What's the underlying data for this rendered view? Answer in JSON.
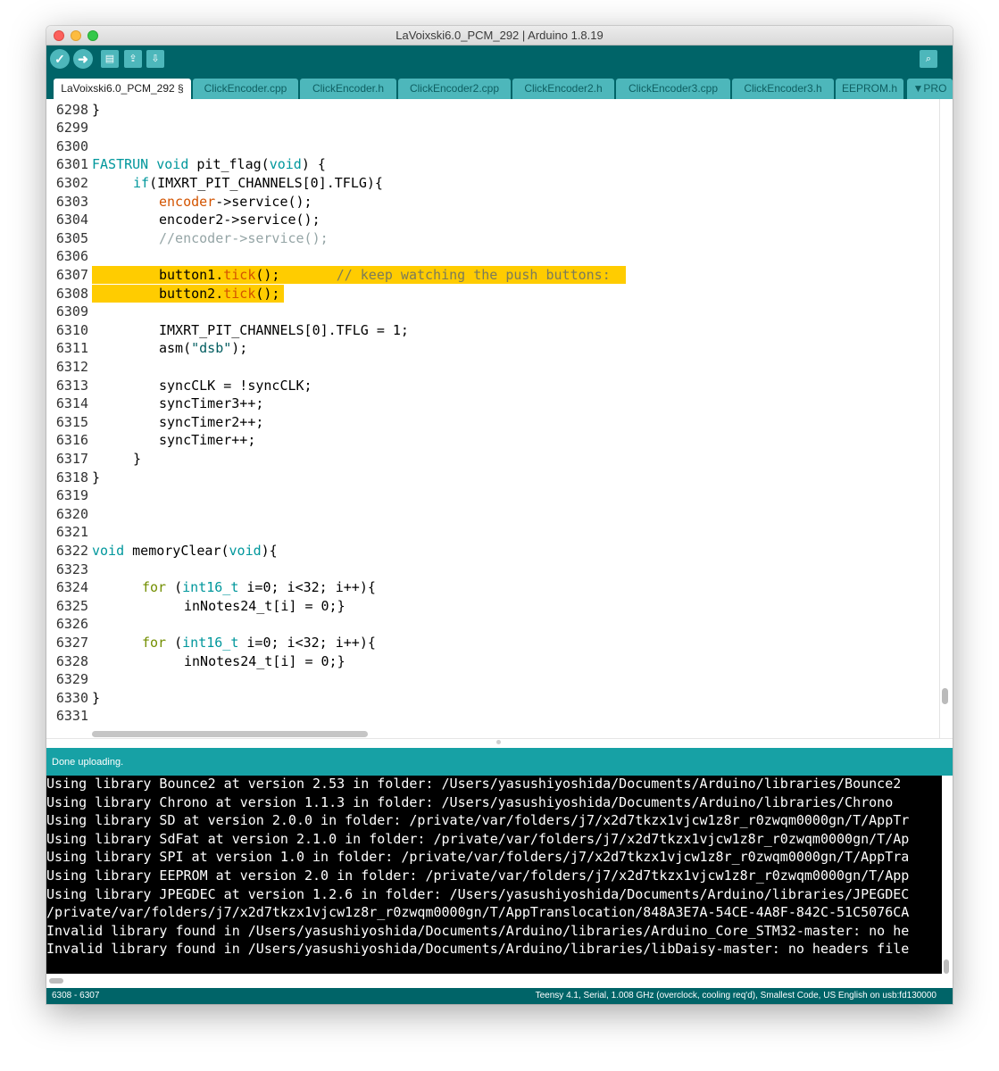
{
  "window": {
    "title": "LaVoixski6.0_PCM_292 | Arduino 1.8.19"
  },
  "traffic_lights": {
    "close_color": "#fc605c",
    "minimize_color": "#fdbc40",
    "zoom_color": "#34c84a"
  },
  "toolbar": {
    "verify_icon": "✓",
    "upload_icon": "➜",
    "new_icon": "▤",
    "open_icon": "⇪",
    "save_icon": "⇩",
    "serial_monitor_icon": "⌕"
  },
  "tabs": [
    {
      "label": "LaVoixski6.0_PCM_292 §",
      "active": true
    },
    {
      "label": "ClickEncoder.cpp"
    },
    {
      "label": "ClickEncoder.h"
    },
    {
      "label": "ClickEncoder2.cpp"
    },
    {
      "label": "ClickEncoder2.h"
    },
    {
      "label": "ClickEncoder3.cpp"
    },
    {
      "label": "ClickEncoder3.h"
    },
    {
      "label": "EEPROM.h"
    },
    {
      "label": "▼PRO"
    }
  ],
  "editor": {
    "line_numbers": [
      "6298",
      "6299",
      "6300",
      "6301",
      "6302",
      "6303",
      "6304",
      "6305",
      "6306",
      "6307",
      "6308",
      "6309",
      "6310",
      "6311",
      "6312",
      "6313",
      "6314",
      "6315",
      "6316",
      "6317",
      "6318",
      "6319",
      "6320",
      "6321",
      "6322",
      "6323",
      "6324",
      "6325",
      "6326",
      "6327",
      "6328",
      "6329",
      "6330",
      "6331"
    ],
    "code": {
      "l6298": "}",
      "l6301_kw1": "FASTRUN",
      "l6301_kw2": "void",
      "l6301_name": " pit_flag(",
      "l6301_kw3": "void",
      "l6301_end": ") {",
      "l6302_kw": "if",
      "l6302_rest": "(IMXRT_PIT_CHANNELS[0].TFLG){",
      "l6303_fn": "encoder",
      "l6303_rest": "->service();",
      "l6304": "encoder2->service();",
      "l6305": "//encoder->service();",
      "l6307_a": "button1.",
      "l6307_fn": "tick",
      "l6307_b": "();       ",
      "l6307_cm": "// keep watching the push buttons:",
      "l6308_a": "button2.",
      "l6308_fn": "tick",
      "l6308_b": "();",
      "l6310": "IMXRT_PIT_CHANNELS[0].TFLG = 1;",
      "l6311_a": "asm(",
      "l6311_str": "\"dsb\"",
      "l6311_b": ");",
      "l6313": "syncCLK = !syncCLK;",
      "l6314": "syncTimer3++;",
      "l6315": "syncTimer2++;",
      "l6316": "syncTimer++;",
      "l6317": "}",
      "l6318": "}",
      "l6322_kw": "void",
      "l6322_name": " memoryClear(",
      "l6322_kw2": "void",
      "l6322_end": "){",
      "l6324_kw": "for",
      "l6324_sp": " (",
      "l6324_type": "int16_t",
      "l6324_rest": " i=0; i<32; i++){",
      "l6325": "inNotes24_t[i] = 0;}",
      "l6327_kw": "for",
      "l6327_sp": " (",
      "l6327_type": "int16_t",
      "l6327_rest": " i=0; i<32; i++){",
      "l6328": "inNotes24_t[i] = 0;}",
      "l6330": "}"
    }
  },
  "status": {
    "message": "Done uploading."
  },
  "console": {
    "lines": [
      "Using library Bounce2 at version 2.53 in folder: /Users/yasushiyoshida/Documents/Arduino/libraries/Bounce2",
      "Using library Chrono at version 1.1.3 in folder: /Users/yasushiyoshida/Documents/Arduino/libraries/Chrono",
      "Using library SD at version 2.0.0 in folder: /private/var/folders/j7/x2d7tkzx1vjcw1z8r_r0zwqm0000gn/T/AppTr",
      "Using library SdFat at version 2.1.0 in folder: /private/var/folders/j7/x2d7tkzx1vjcw1z8r_r0zwqm0000gn/T/Ap",
      "Using library SPI at version 1.0 in folder: /private/var/folders/j7/x2d7tkzx1vjcw1z8r_r0zwqm0000gn/T/AppTra",
      "Using library EEPROM at version 2.0 in folder: /private/var/folders/j7/x2d7tkzx1vjcw1z8r_r0zwqm0000gn/T/App",
      "Using library JPEGDEC at version 1.2.6 in folder: /Users/yasushiyoshida/Documents/Arduino/libraries/JPEGDEC",
      "/private/var/folders/j7/x2d7tkzx1vjcw1z8r_r0zwqm0000gn/T/AppTranslocation/848A3E7A-54CE-4A8F-842C-51C5076CA",
      "Invalid library found in /Users/yasushiyoshida/Documents/Arduino/libraries/Arduino_Core_STM32-master: no he",
      "Invalid library found in /Users/yasushiyoshida/Documents/Arduino/libraries/libDaisy-master: no headers file"
    ]
  },
  "footer": {
    "line_range": "6308 - 6307",
    "board_info": "Teensy 4.1, Serial, 1.008 GHz (overclock, cooling req'd), Smallest Code, US English on usb:fd130000"
  },
  "colors": {
    "teal_dark": "#006468",
    "teal_light": "#17a1a5",
    "tab_inactive": "#4db7bb",
    "highlight": "#ffcc00",
    "keyword": "#00979c",
    "function": "#d35400"
  }
}
